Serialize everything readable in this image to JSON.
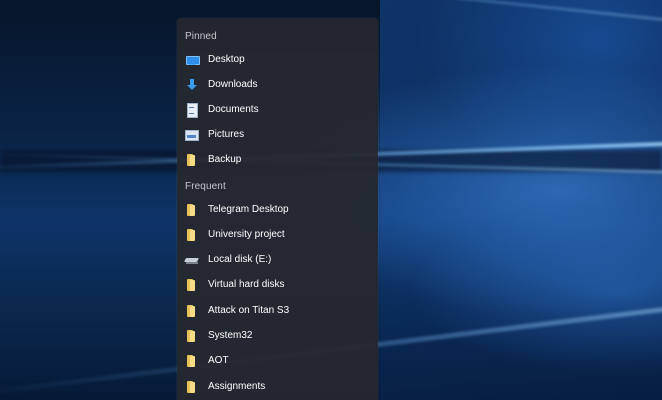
{
  "jumplist": {
    "pinned": {
      "header": "Pinned",
      "items": [
        {
          "label": "Desktop",
          "icon": "desktop-icon"
        },
        {
          "label": "Downloads",
          "icon": "download-icon"
        },
        {
          "label": "Documents",
          "icon": "documents-icon"
        },
        {
          "label": "Pictures",
          "icon": "pictures-icon"
        },
        {
          "label": "Backup",
          "icon": "folder-icon"
        }
      ]
    },
    "frequent": {
      "header": "Frequent",
      "items": [
        {
          "label": "Telegram Desktop",
          "icon": "folder-icon"
        },
        {
          "label": "University project",
          "icon": "folder-icon"
        },
        {
          "label": "Local disk (E:)",
          "icon": "drive-icon"
        },
        {
          "label": "Virtual hard disks",
          "icon": "folder-icon"
        },
        {
          "label": "Attack on Titan S3",
          "icon": "folder-icon"
        },
        {
          "label": "System32",
          "icon": "folder-icon"
        },
        {
          "label": "AOT",
          "icon": "folder-icon"
        },
        {
          "label": "Assignments",
          "icon": "folder-icon"
        }
      ]
    }
  },
  "colors": {
    "menu_background": "#26282e",
    "header_text": "#c4c6cc",
    "item_text": "#ffffff",
    "folder_yellow": "#e8c35a",
    "accent_blue": "#2f8ee9",
    "wallpaper_blue": "#0d3468"
  }
}
